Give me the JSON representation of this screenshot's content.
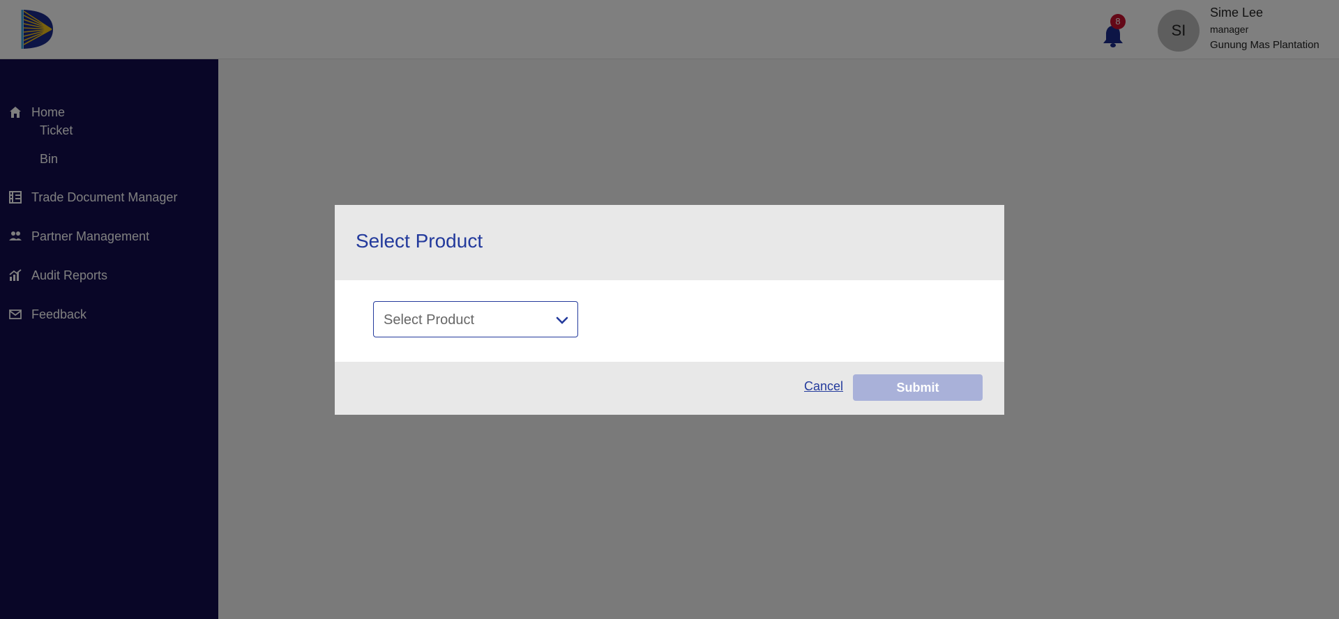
{
  "header": {
    "logo": "app-logo",
    "notifications": {
      "icon": "bell-icon",
      "count": "8"
    },
    "user": {
      "initials": "SI",
      "name": "Sime Lee",
      "role": "manager",
      "org": "Gunung Mas Plantation"
    }
  },
  "sidebar": {
    "items": [
      {
        "label": "Home",
        "icon": "home-icon"
      },
      {
        "label": "Ticket"
      },
      {
        "label": "Bin"
      },
      {
        "label": "Trade Document Manager",
        "icon": "building-icon"
      },
      {
        "label": "Partner Management",
        "icon": "people-icon"
      },
      {
        "label": "Audit Reports",
        "icon": "chart-icon"
      },
      {
        "label": "Feedback",
        "icon": "mail-icon"
      }
    ]
  },
  "modal": {
    "title": "Select Product",
    "select": {
      "placeholder": "Select Product",
      "icon": "chevron-down-icon"
    },
    "cancel_label": "Cancel",
    "submit_label": "Submit"
  },
  "colors": {
    "sidebar_bg": "#120d4e",
    "accent": "#233a9c",
    "badge": "#c8102e",
    "submit_disabled": "#a9b1d9"
  }
}
